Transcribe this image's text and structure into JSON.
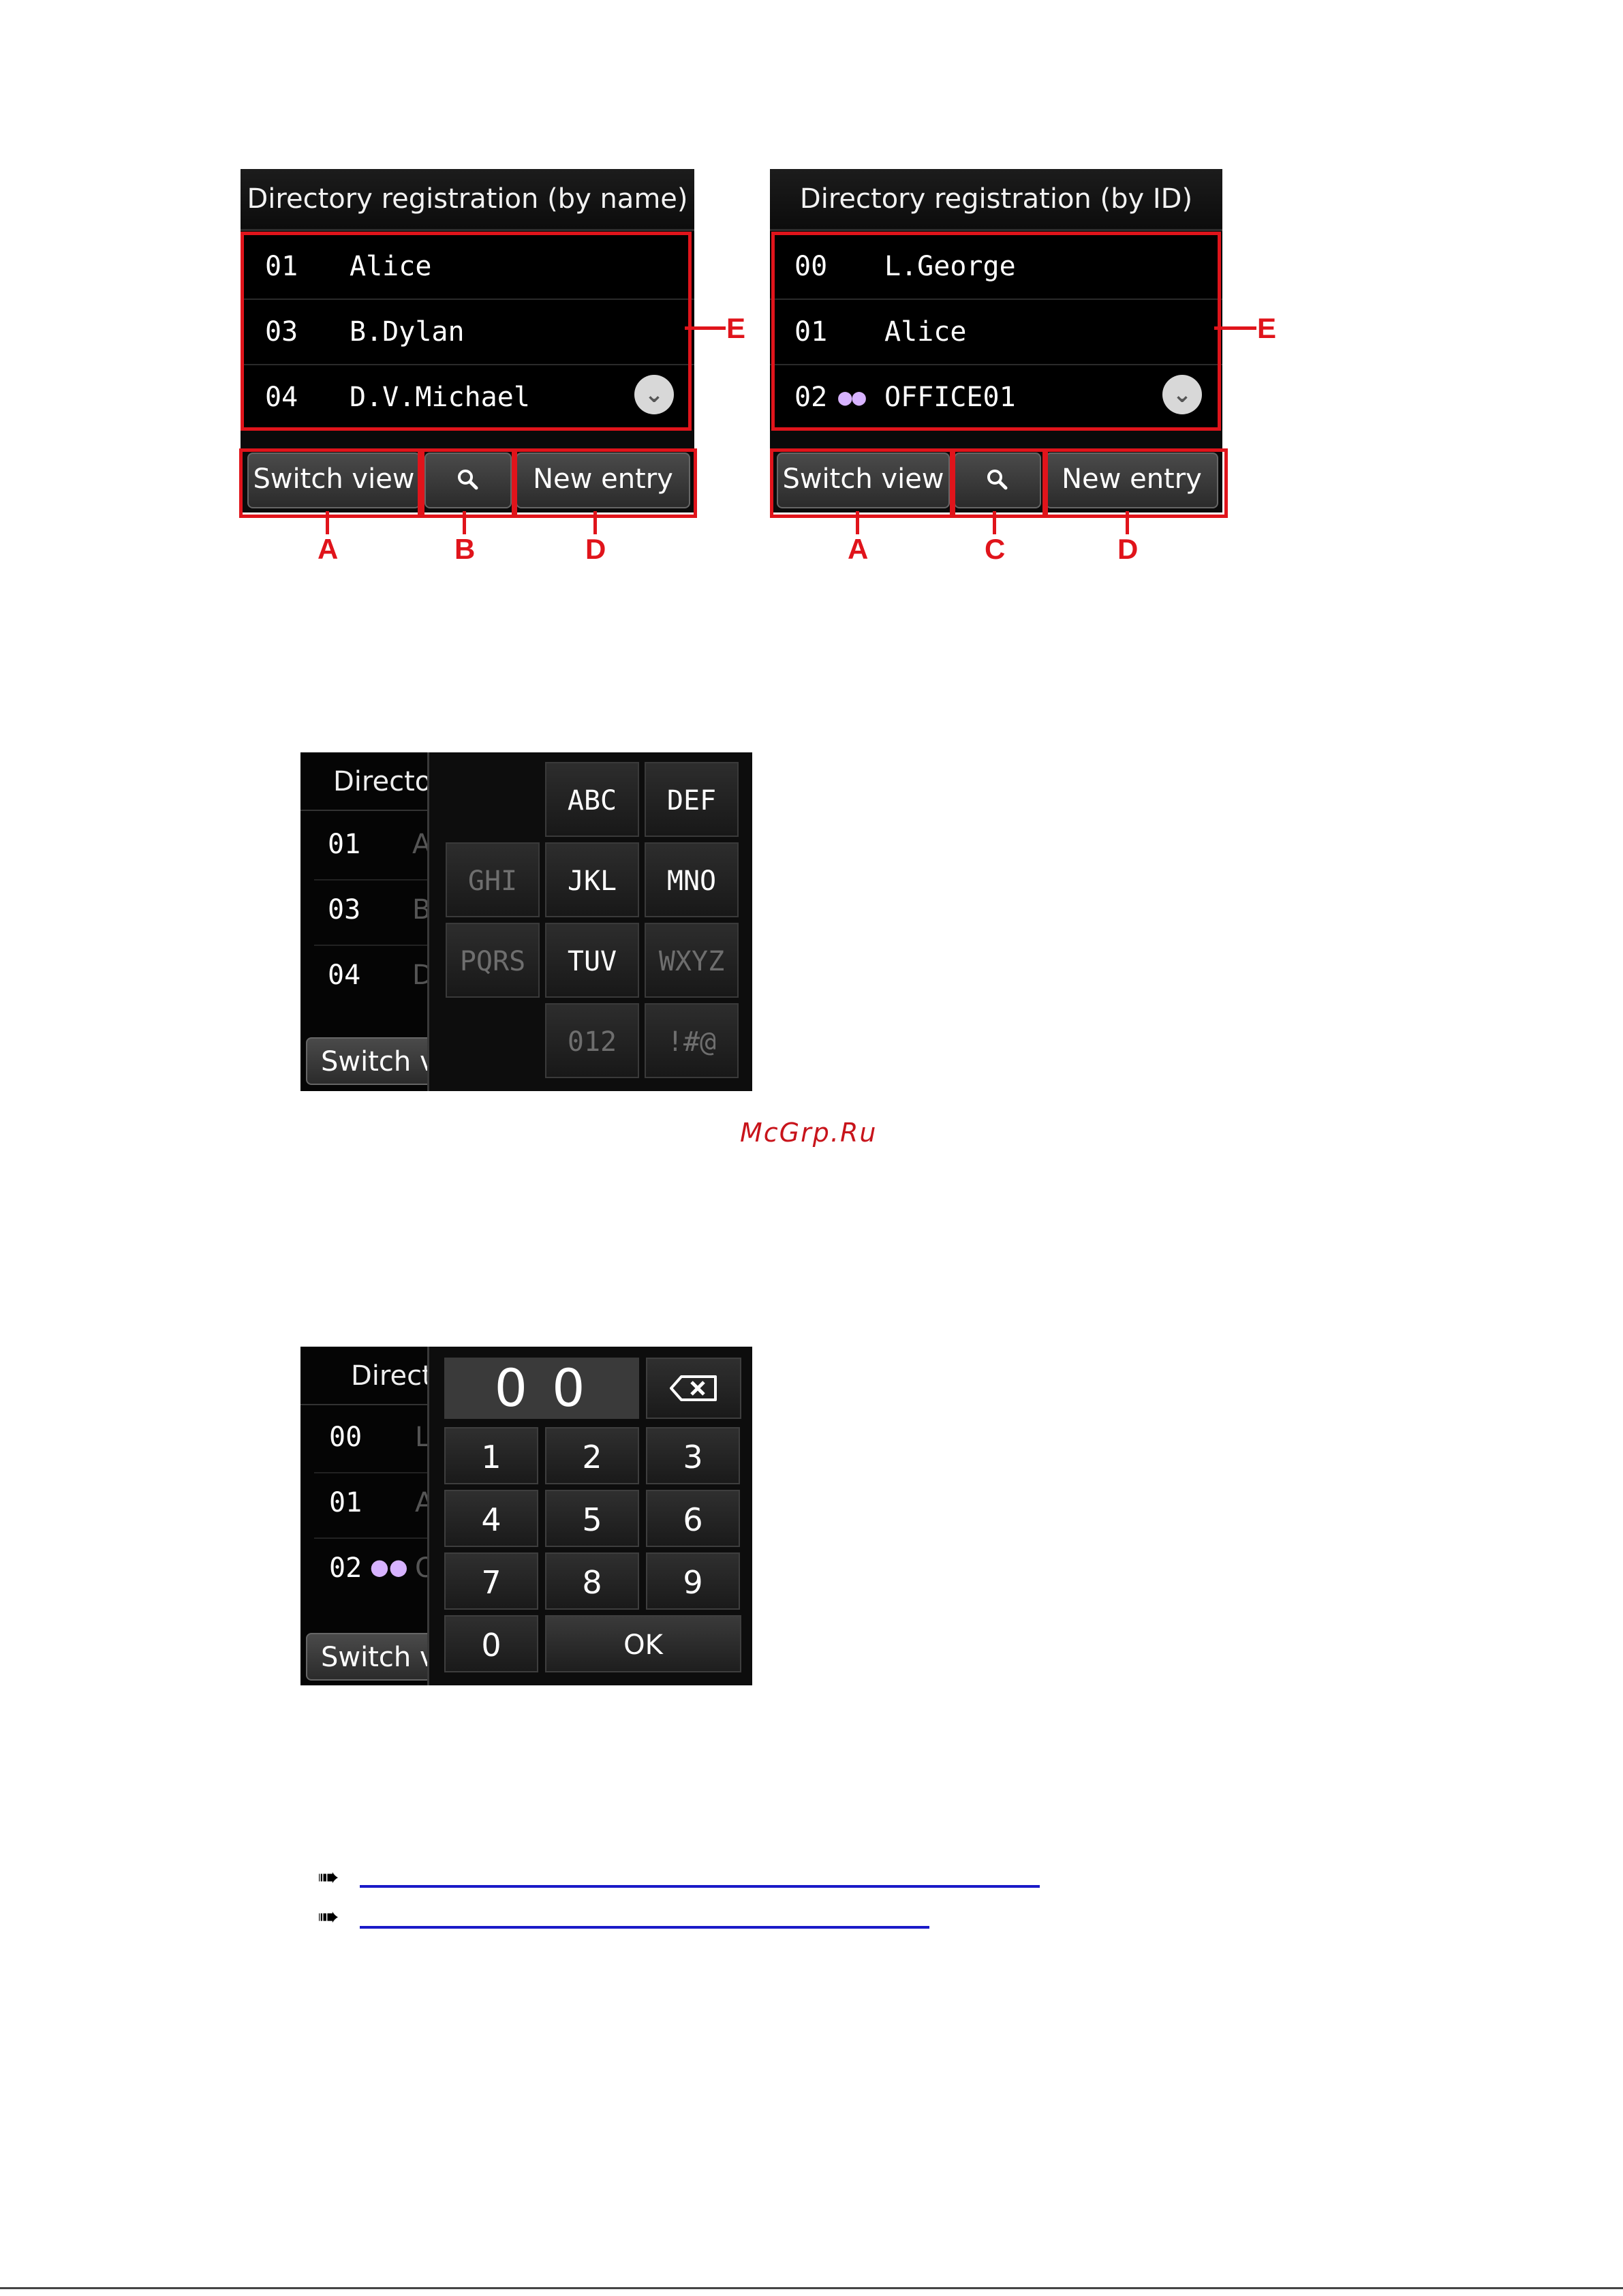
{
  "screen_by_name": {
    "title": "Directory registration (by name)",
    "rows": [
      {
        "num": "01",
        "name": "Alice"
      },
      {
        "num": "03",
        "name": "B.Dylan"
      },
      {
        "num": "04",
        "name": "D.V.Michael"
      }
    ],
    "buttons": {
      "switch_view": "Switch view",
      "new_entry": "New entry"
    },
    "callouts": {
      "a": "A",
      "b": "B",
      "d": "D",
      "e": "E"
    }
  },
  "screen_by_id": {
    "title": "Directory registration (by ID)",
    "rows": [
      {
        "num": "00",
        "name": "L.George"
      },
      {
        "num": "01",
        "name": "Alice"
      },
      {
        "num": "02",
        "name": "OFFICE01"
      }
    ],
    "buttons": {
      "switch_view": "Switch view",
      "new_entry": "New entry"
    },
    "callouts": {
      "a": "A",
      "c": "C",
      "d": "D",
      "e": "E"
    }
  },
  "keypad_name": {
    "title_partial": "Director",
    "rows": [
      "01",
      "03",
      "04"
    ],
    "row_letters": [
      "A",
      "B",
      "D"
    ],
    "switch_partial": "Switch vi",
    "keys": [
      "ABC",
      "DEF",
      "GHI",
      "JKL",
      "MNO",
      "PQRS",
      "TUV",
      "WXYZ",
      "012",
      "!#@"
    ]
  },
  "keypad_id": {
    "title_partial": "Direct",
    "rows": [
      "00",
      "01",
      "02"
    ],
    "row_letters": [
      "L",
      "A",
      "O"
    ],
    "switch_partial": "Switch vi",
    "display": "0 0",
    "keys": [
      "1",
      "2",
      "3",
      "4",
      "5",
      "6",
      "7",
      "8",
      "9",
      "0"
    ],
    "ok": "OK"
  },
  "watermark": "McGrp.Ru",
  "icons": {
    "search": "search-icon",
    "scroll": "chevron-down-icon",
    "group": "group-icon",
    "backspace": "backspace-icon",
    "link_arrow": "arrow-right-icon"
  }
}
